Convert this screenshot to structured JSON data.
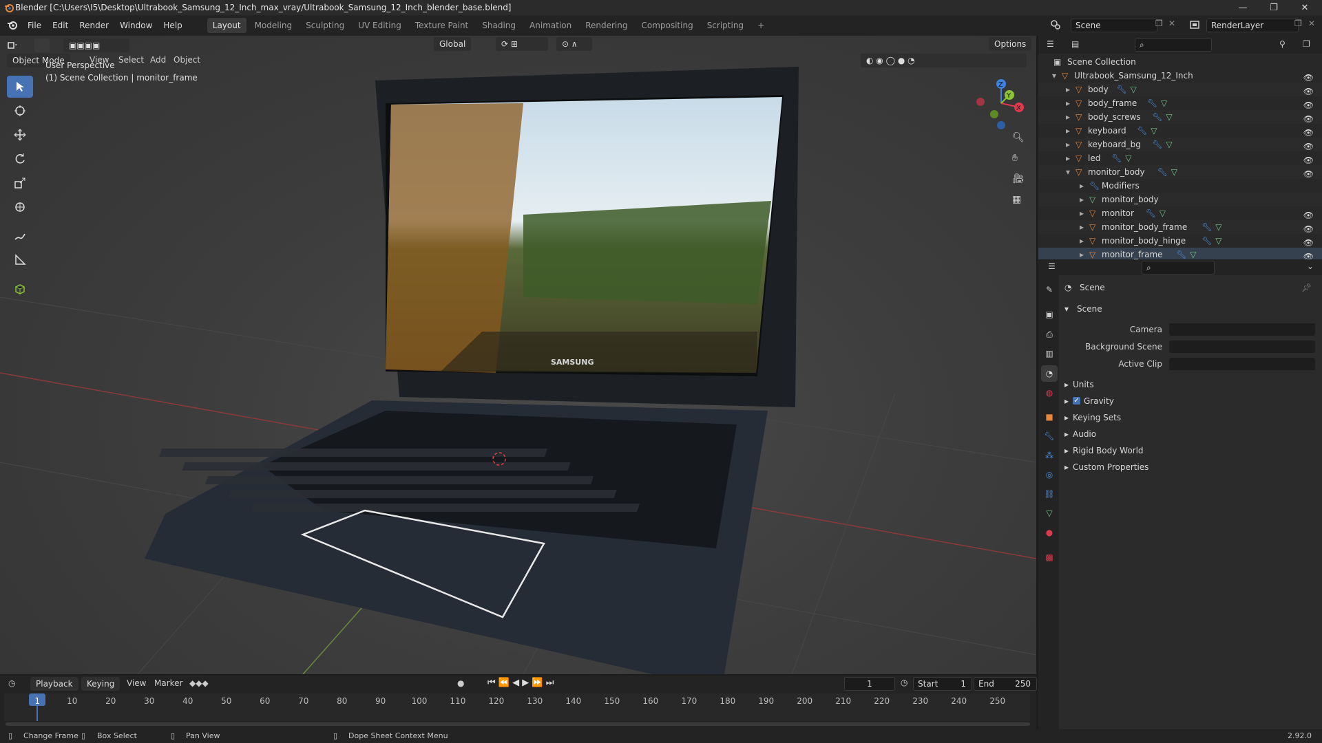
{
  "window": {
    "title": "Blender [C:\\Users\\I5\\Desktop\\Ultrabook_Samsung_12_Inch_max_vray/Ultrabook_Samsung_12_Inch_blender_base.blend]",
    "minimize": "—",
    "maximize": "❐",
    "close": "✕"
  },
  "menu": [
    "File",
    "Edit",
    "Render",
    "Window",
    "Help"
  ],
  "workspaces": [
    "Layout",
    "Modeling",
    "Sculpting",
    "UV Editing",
    "Texture Paint",
    "Shading",
    "Animation",
    "Rendering",
    "Compositing",
    "Scripting"
  ],
  "workspace_add": "+",
  "scene": {
    "label": "Scene",
    "render_layer": "RenderLayer"
  },
  "viewport_header": {
    "mode": "Object Mode",
    "items": [
      "View",
      "Select",
      "Add",
      "Object"
    ],
    "transform": "Global",
    "options": "Options"
  },
  "viewport": {
    "perspective": "User Perspective",
    "collection_info": "(1) Scene Collection | monitor_frame",
    "brand": "SAMSUNG",
    "gizmo": {
      "x": "X",
      "y": "Y",
      "z": "Z"
    }
  },
  "outliner": {
    "root": "Scene Collection",
    "items": [
      {
        "name": "Ultrabook_Samsung_12_Inch",
        "indent": 1,
        "kind": "collection"
      },
      {
        "name": "body",
        "indent": 2,
        "kind": "object"
      },
      {
        "name": "body_frame",
        "indent": 2,
        "kind": "object"
      },
      {
        "name": "body_screws",
        "indent": 2,
        "kind": "object"
      },
      {
        "name": "keyboard",
        "indent": 2,
        "kind": "object"
      },
      {
        "name": "keyboard_bg",
        "indent": 2,
        "kind": "object"
      },
      {
        "name": "led",
        "indent": 2,
        "kind": "object"
      },
      {
        "name": "monitor_body",
        "indent": 2,
        "kind": "object"
      },
      {
        "name": "Modifiers",
        "indent": 3,
        "kind": "modifier"
      },
      {
        "name": "monitor_body",
        "indent": 3,
        "kind": "mesh"
      },
      {
        "name": "monitor",
        "indent": 3,
        "kind": "object"
      },
      {
        "name": "monitor_body_frame",
        "indent": 3,
        "kind": "object"
      },
      {
        "name": "monitor_body_hinge",
        "indent": 3,
        "kind": "object"
      },
      {
        "name": "monitor_frame",
        "indent": 3,
        "kind": "object"
      }
    ]
  },
  "properties": {
    "context": "Scene",
    "panel": "Scene",
    "fields": [
      {
        "label": "Camera"
      },
      {
        "label": "Background Scene"
      },
      {
        "label": "Active Clip"
      }
    ],
    "sections": [
      "Units",
      "Gravity",
      "Keying Sets",
      "Audio",
      "Rigid Body World",
      "Custom Properties"
    ]
  },
  "timeline": {
    "menus": [
      "Playback",
      "Keying",
      "View",
      "Marker"
    ],
    "current_frame": "1",
    "start_label": "Start",
    "start": "1",
    "end_label": "End",
    "end": "250",
    "ticks": [
      "1",
      "10",
      "20",
      "30",
      "40",
      "50",
      "60",
      "70",
      "80",
      "90",
      "100",
      "110",
      "120",
      "130",
      "140",
      "150",
      "160",
      "170",
      "180",
      "190",
      "200",
      "210",
      "220",
      "230",
      "240",
      "250"
    ]
  },
  "status": {
    "items": [
      "Change Frame",
      "Box Select",
      "Pan View",
      "Dope Sheet Context Menu"
    ],
    "version": "2.92.0"
  },
  "colors": {
    "accent": "#4772b3",
    "object": "#e8863a",
    "mesh": "#74c68a",
    "x_axis": "#e0394e",
    "y_axis": "#8bc434",
    "z_axis": "#3d82e0"
  }
}
